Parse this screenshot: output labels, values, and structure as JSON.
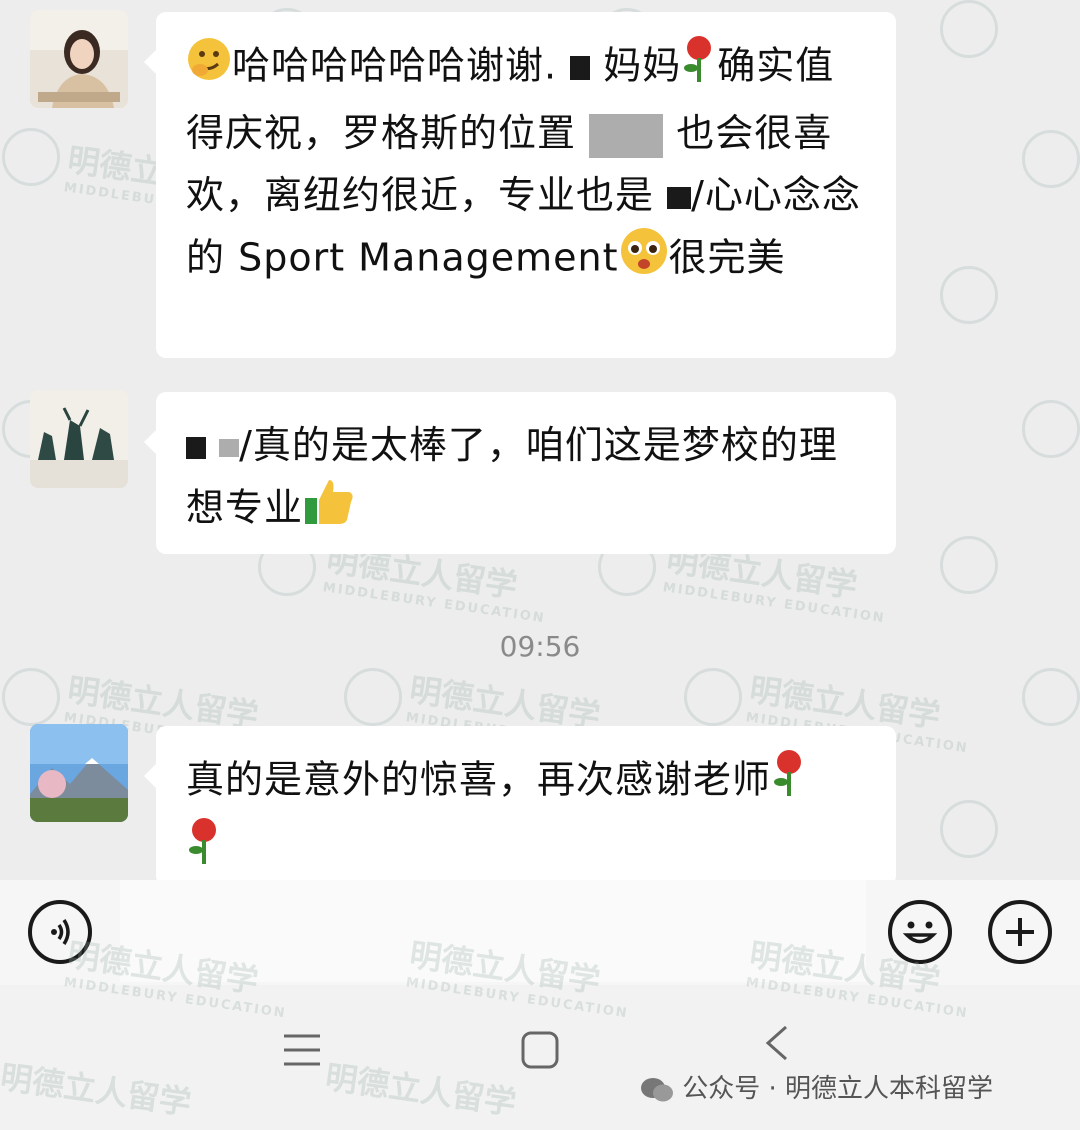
{
  "messages": [
    {
      "sender": "user-mom",
      "parts": [
        "哈哈哈哈哈哈谢谢.",
        "妈妈",
        "确实值得庆祝，罗格斯的位置",
        "也会很喜欢，离纽约很近，专业也是",
        "/心心念念的 Sport Management",
        "很完美"
      ]
    },
    {
      "sender": "teacher",
      "parts": [
        "/真的是太棒了，咱们这是梦校的理想专业"
      ]
    },
    {
      "sender": "user-mom",
      "parts": [
        "真的是意外的惊喜，再次感谢老师"
      ]
    }
  ],
  "timestamp": "09:56",
  "input": {
    "placeholder": ""
  },
  "footer": {
    "label": "公众号 · 明德立人本科留学"
  },
  "watermark": {
    "cn": "明德立人留学",
    "en": "MIDDLEBURY EDUCATION"
  },
  "icons": {
    "voice": "voice-icon",
    "emoji": "emoji-icon",
    "plus": "plus-icon",
    "menu": "menu-icon",
    "home": "home-icon",
    "back": "back-icon",
    "wechat": "wechat-icon"
  },
  "colors": {
    "background": "#ededed",
    "bubble": "#ffffff",
    "timestamp": "#8a8a8a"
  }
}
